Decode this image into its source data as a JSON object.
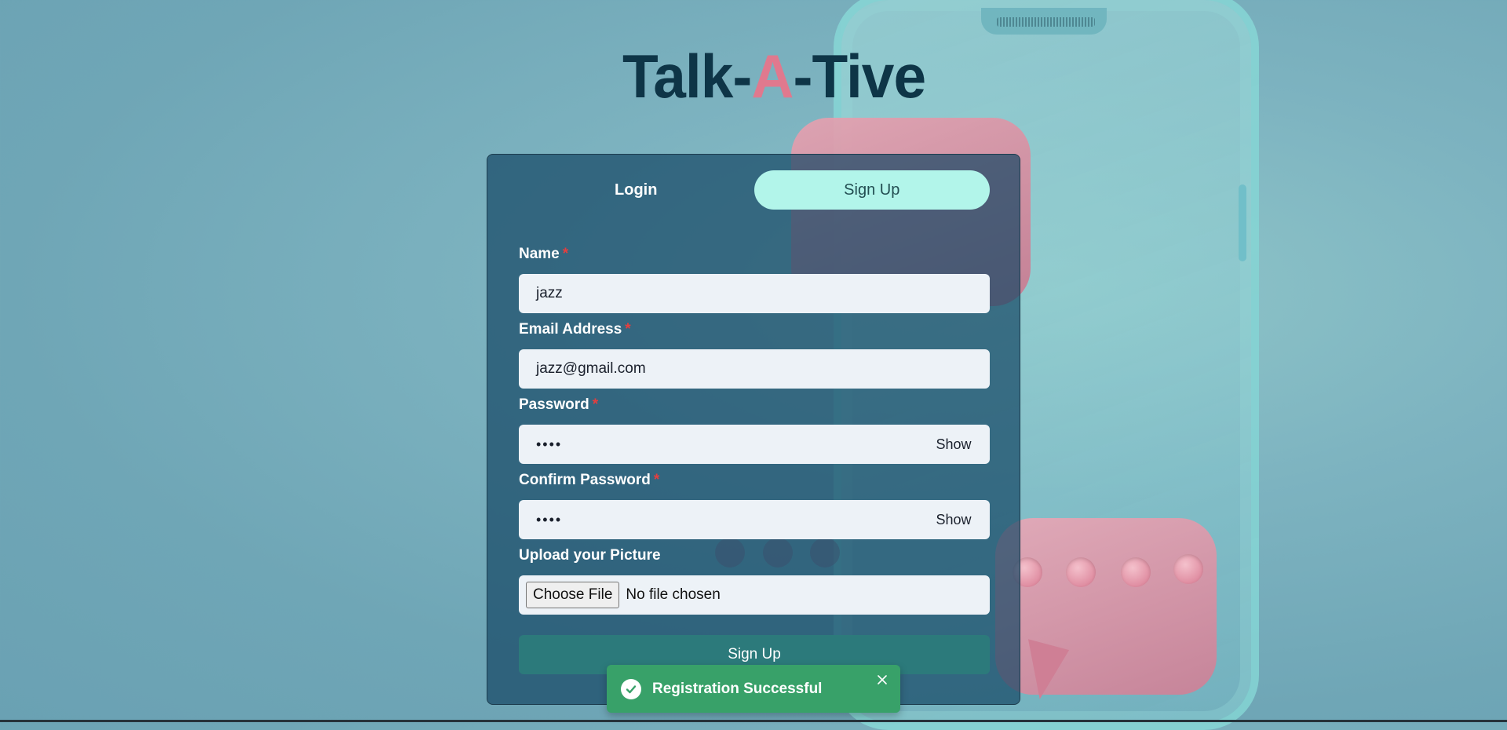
{
  "app": {
    "logo_part1": "Talk-",
    "logo_accent": "A",
    "logo_part2": "-Tive"
  },
  "tabs": [
    {
      "label": "Login",
      "active": false
    },
    {
      "label": "Sign Up",
      "active": true
    }
  ],
  "form": {
    "required_marker": "*",
    "name": {
      "label": "Name",
      "value": "jazz",
      "required": true
    },
    "email": {
      "label": "Email Address",
      "value": "jazz@gmail.com",
      "required": true
    },
    "password": {
      "label": "Password",
      "value": "••••",
      "toggle_label": "Show",
      "required": true
    },
    "confirm_password": {
      "label": "Confirm Password",
      "value": "••••",
      "toggle_label": "Show",
      "required": true
    },
    "picture": {
      "label": "Upload your Picture",
      "button_label": "Choose File",
      "status": "No file chosen"
    },
    "submit_label": "Sign Up"
  },
  "toast": {
    "title": "Registration Successful",
    "status": "success",
    "icon": "check-circle-icon",
    "close_icon": "close-icon"
  },
  "colors": {
    "brand_dark": "#0e3547",
    "brand_accent": "#e0798e",
    "active_tab": "#b2f5ea",
    "submit_button": "#2c7a7b",
    "toast_success": "#38a169",
    "required": "#e53e3e"
  }
}
